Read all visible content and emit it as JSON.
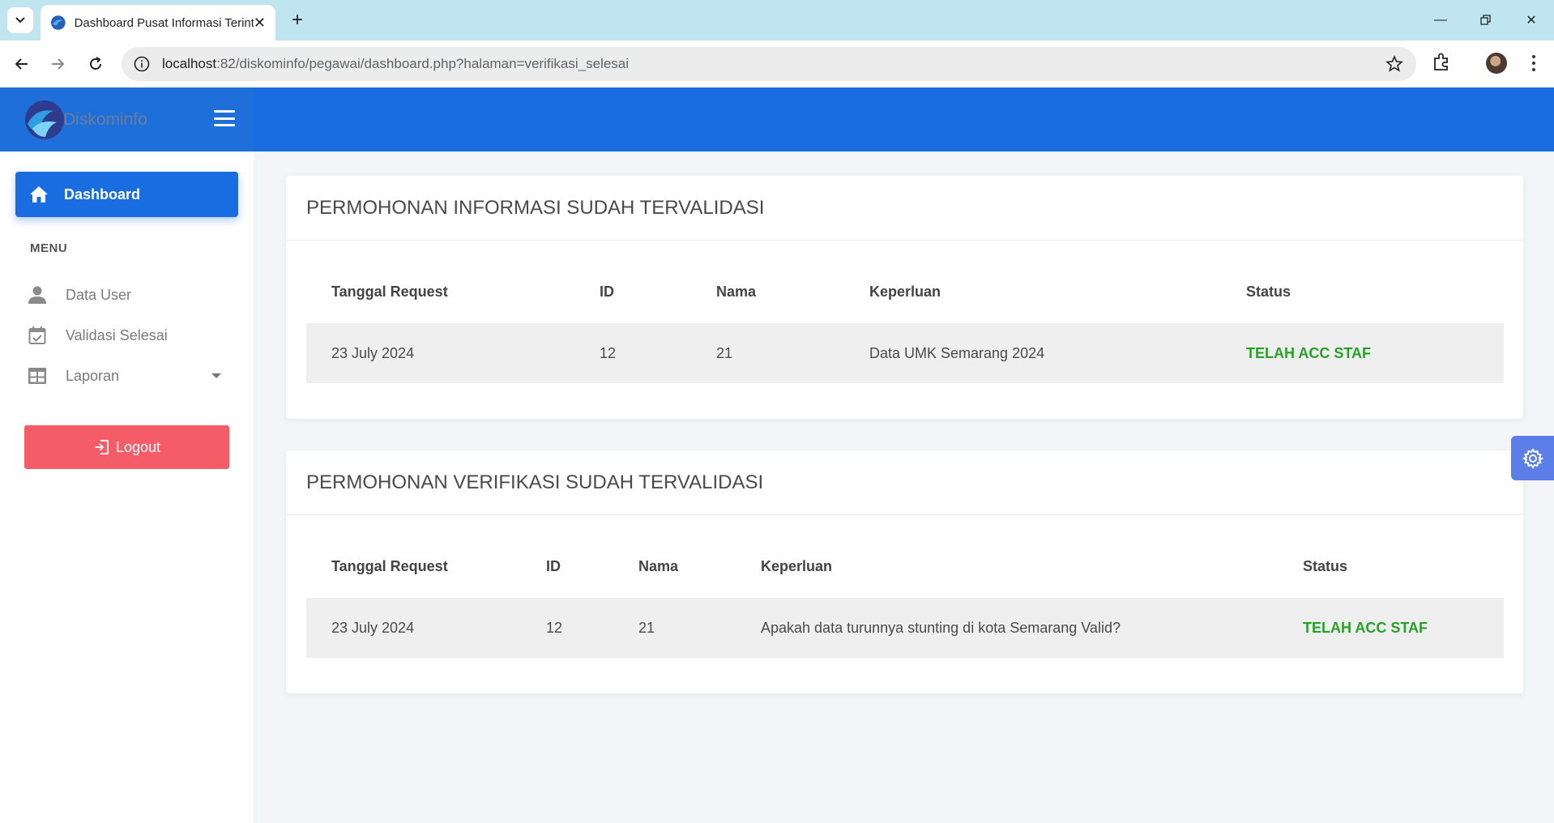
{
  "browser": {
    "tab_title": "Dashboard Pusat Informasi Terintegrasi",
    "url_host": "localhost",
    "url_rest": ":82/diskominfo/pegawai/dashboard.php?halaman=verifikasi_selesai"
  },
  "app": {
    "brand": "Diskominfo",
    "accent": "#1a6de0"
  },
  "sidebar": {
    "dashboard_label": "Dashboard",
    "menu_heading": "MENU",
    "items": [
      {
        "label": "Data User",
        "icon": "user-icon"
      },
      {
        "label": "Validasi Selesai",
        "icon": "calendar-check-icon"
      },
      {
        "label": "Laporan",
        "icon": "table-icon"
      }
    ],
    "logout_label": "Logout"
  },
  "cards": [
    {
      "title": "PERMOHONAN INFORMASI SUDAH TERVALIDASI",
      "headers": [
        "Tanggal Request",
        "ID",
        "Nama",
        "Keperluan",
        "Status"
      ],
      "rows": [
        [
          "23 July 2024",
          "12",
          "21",
          "Data UMK Semarang 2024",
          "TELAH ACC STAF"
        ]
      ]
    },
    {
      "title": "PERMOHONAN VERIFIKASI SUDAH TERVALIDASI",
      "headers": [
        "Tanggal Request",
        "ID",
        "Nama",
        "Keperluan",
        "Status"
      ],
      "rows": [
        [
          "23 July 2024",
          "12",
          "21",
          "Apakah data turunnya stunting di kota Semarang Valid?",
          "TELAH ACC STAF"
        ]
      ]
    }
  ]
}
